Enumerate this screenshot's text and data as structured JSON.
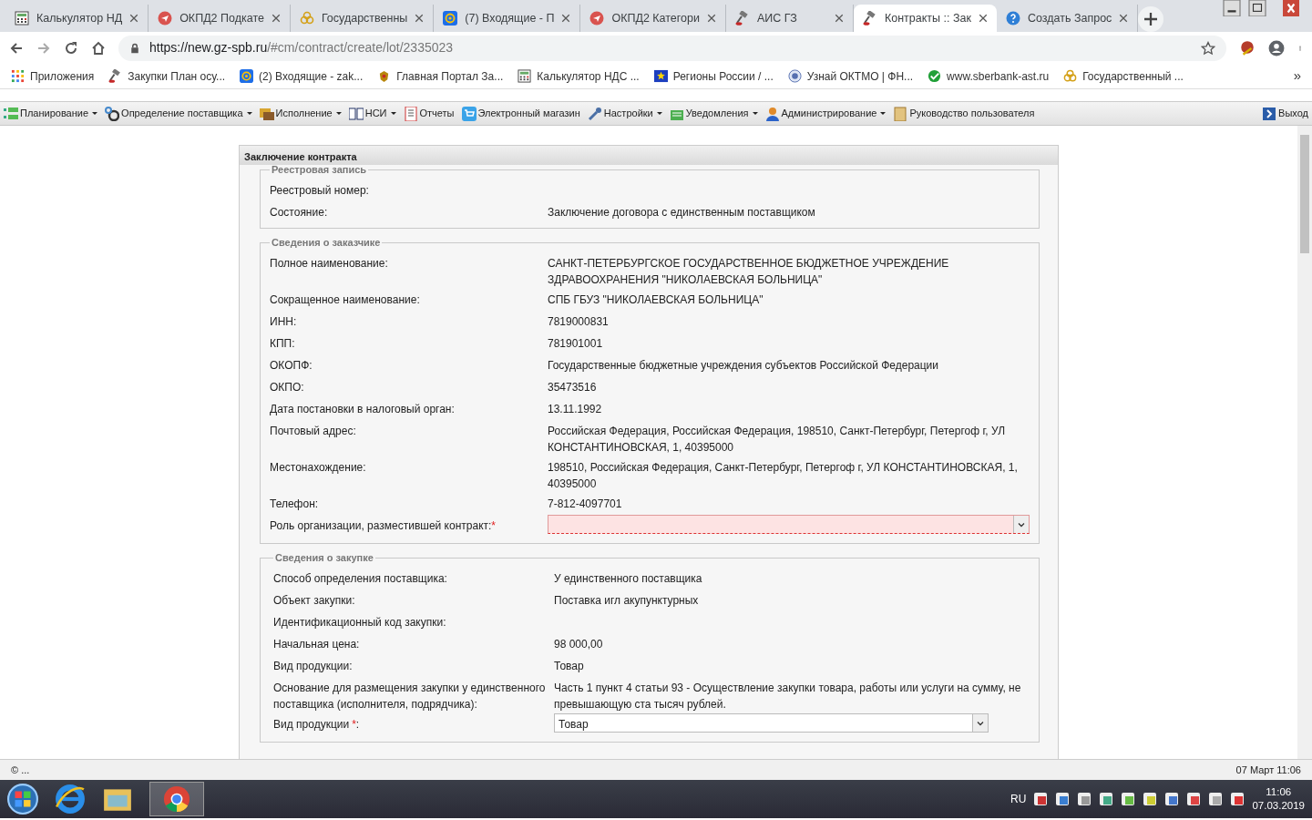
{
  "browser": {
    "tabs": [
      {
        "title": "Калькулятор НД",
        "selected": false
      },
      {
        "title": "ОКПД2 Подкате",
        "selected": false
      },
      {
        "title": "Государственны",
        "selected": false
      },
      {
        "title": "(7) Входящие - П",
        "selected": false
      },
      {
        "title": "ОКПД2 Категори",
        "selected": false
      },
      {
        "title": "АИС ГЗ",
        "selected": false
      },
      {
        "title": "Контракты :: Зак",
        "selected": true
      },
      {
        "title": "Создать Запрос",
        "selected": false
      }
    ],
    "url_host": "https://new.gz-spb.ru",
    "url_path": "/#cm/contract/create/lot/2335023",
    "bookmarks": [
      {
        "title": "Приложения"
      },
      {
        "title": "Закупки План осу..."
      },
      {
        "title": "(2) Входящие - zak..."
      },
      {
        "title": "Главная Портал За..."
      },
      {
        "title": "Калькулятор НДС ..."
      },
      {
        "title": "Регионы России / ..."
      },
      {
        "title": "Узнай ОКТМО | ФН..."
      },
      {
        "title": "www.sberbank-ast.ru"
      },
      {
        "title": "Государственный ..."
      }
    ],
    "bookmarks_more": "»"
  },
  "menu": {
    "items": [
      {
        "label": "Планирование",
        "dropdown": true
      },
      {
        "label": "Определение поставщика",
        "dropdown": true
      },
      {
        "label": "Исполнение",
        "dropdown": true
      },
      {
        "label": "НСИ",
        "dropdown": true
      },
      {
        "label": "Отчеты",
        "dropdown": false
      },
      {
        "label": "Электронный магазин",
        "dropdown": false
      },
      {
        "label": "Настройки",
        "dropdown": true
      },
      {
        "label": "Уведомления",
        "dropdown": true
      },
      {
        "label": "Администрирование",
        "dropdown": true
      },
      {
        "label": "Руководство пользователя",
        "dropdown": false
      }
    ],
    "exit": "Выход"
  },
  "panel": {
    "title": "Заключение контракта",
    "sections": [
      {
        "legend": "Реестровая запись",
        "rows": [
          {
            "label": "Реестровый номер:",
            "kind": "text"
          },
          {
            "label": "Состояние:",
            "kind": "text",
            "value": "Заключение договора с единственным поставщиком"
          }
        ]
      },
      {
        "legend": "Сведения о заказчике",
        "rows": [
          {
            "label": "Полное наименование:",
            "kind": "text",
            "value": "САНКТ-ПЕТЕРБУРГСКОЕ ГОСУДАРСТВЕННОЕ БЮДЖЕТНОЕ УЧРЕЖДЕНИЕ ЗДРАВООХРАНЕНИЯ \"НИКОЛАЕВСКАЯ БОЛЬНИЦА\""
          },
          {
            "label": "Сокращенное наименование:",
            "kind": "text",
            "value": "СПБ ГБУЗ \"НИКОЛАЕВСКАЯ БОЛЬНИЦА\""
          },
          {
            "label": "ИНН:",
            "kind": "text",
            "value": "7819000831"
          },
          {
            "label": "КПП:",
            "kind": "text",
            "value": "781901001"
          },
          {
            "label": "ОКОПФ:",
            "kind": "text",
            "value": "Государственные бюджетные учреждения субъектов Российской Федерации"
          },
          {
            "label": "ОКПО:",
            "kind": "text",
            "value": "35473516"
          },
          {
            "label": "Дата постановки в налоговый орган:",
            "kind": "text",
            "value": "13.11.1992"
          },
          {
            "label": "Почтовый адрес:",
            "kind": "text",
            "value": "Российская Федерация, Российская Федерация, 198510, Санкт-Петербург, Петергоф г, УЛ КОНСТАНТИНОВСКАЯ, 1, 40395000"
          },
          {
            "label": "Местонахождение:",
            "kind": "text",
            "value": "198510, Российская Федерация, Санкт-Петербург, Петергоф г, УЛ КОНСТАНТИНОВСКАЯ, 1, 40395000"
          },
          {
            "label": "Телефон:",
            "kind": "text",
            "value": "7-812-4097701"
          },
          {
            "label": "Роль организации, разместившей контракт:",
            "required_mark": "*",
            "kind": "select",
            "invalid": true
          }
        ]
      },
      {
        "legend": "Сведения о закупке",
        "rows": [
          {
            "label": "Способ определения поставщика:",
            "kind": "text",
            "value": "У единственного поставщика"
          },
          {
            "label": "Объект закупки:",
            "kind": "text",
            "value": "Поставка игл акупунктурных"
          },
          {
            "label": "Идентификационный код закупки:",
            "kind": "text"
          },
          {
            "label": "Начальная цена:",
            "kind": "text",
            "value": "98 000,00"
          },
          {
            "label": "Вид продукции:",
            "kind": "text",
            "value": "Товар"
          },
          {
            "label": "Основание для размещения закупки у единственного поставщика (исполнителя, подрядчика):",
            "kind": "text",
            "value": "Часть 1 пункт 4 статьи 93 - Осуществление закупки товара, работы или услуги на сумму, не превышающую ста тысяч рублей."
          },
          {
            "label": "Вид продукции",
            "required_mark": "*",
            "after": ":",
            "kind": "select",
            "invalid": false,
            "value": "Товар"
          }
        ]
      }
    ]
  },
  "status_bar": {
    "left": "© ...",
    "right": "07 Март 11:06"
  },
  "taskbar": {
    "language": "RU",
    "time": "11:06",
    "date": "07.03.2019"
  }
}
